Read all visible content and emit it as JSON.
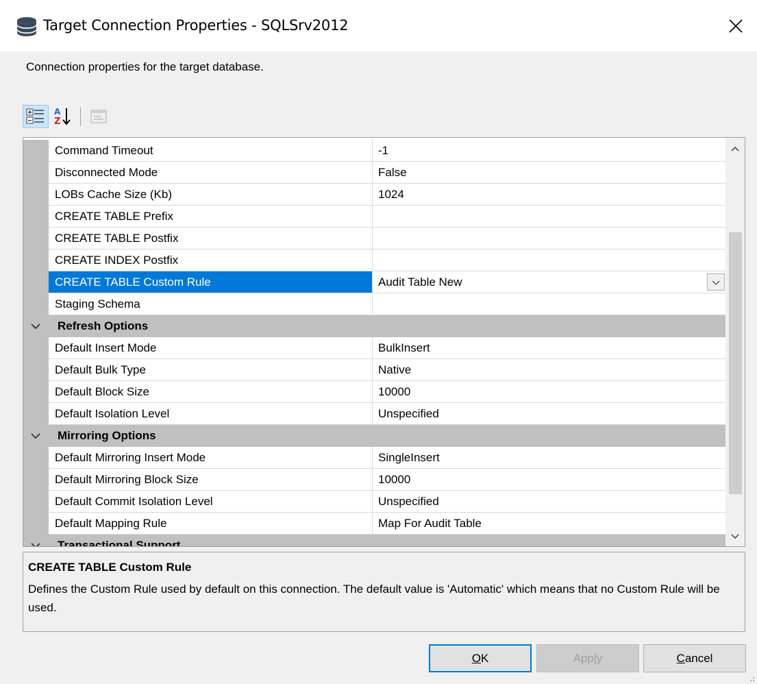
{
  "window": {
    "title": "Target Connection Properties - SQLSrv2012",
    "description": "Connection properties for the target database."
  },
  "toolbar": {
    "buttons": [
      {
        "icon": "categorized-icon",
        "active": true
      },
      {
        "icon": "alphabetical-sort-icon",
        "active": false
      },
      {
        "icon": "property-pages-icon",
        "active": false,
        "disabled": true
      }
    ]
  },
  "grid": {
    "rows_top": [
      {
        "name": "Command Timeout",
        "value": "-1"
      },
      {
        "name": "Disconnected Mode",
        "value": "False"
      },
      {
        "name": "LOBs Cache Size (Kb)",
        "value": "1024"
      },
      {
        "name": "CREATE TABLE Prefix",
        "value": ""
      },
      {
        "name": "CREATE TABLE Postfix",
        "value": ""
      },
      {
        "name": "CREATE INDEX Postfix",
        "value": ""
      },
      {
        "name": "CREATE TABLE Custom Rule",
        "value": "Audit Table New",
        "selected": true
      },
      {
        "name": "Staging Schema",
        "value": ""
      }
    ],
    "refresh": {
      "label": "Refresh Options",
      "rows": [
        {
          "name": "Default Insert Mode",
          "value": "BulkInsert"
        },
        {
          "name": "Default Bulk Type",
          "value": "Native"
        },
        {
          "name": "Default Block Size",
          "value": "10000"
        },
        {
          "name": "Default Isolation Level",
          "value": "Unspecified"
        }
      ]
    },
    "mirroring": {
      "label": "Mirroring Options",
      "rows": [
        {
          "name": "Default Mirroring Insert Mode",
          "value": "SingleInsert"
        },
        {
          "name": "Default Mirroring Block Size",
          "value": "10000"
        },
        {
          "name": "Default Commit Isolation Level",
          "value": "Unspecified"
        },
        {
          "name": "Default Mapping Rule",
          "value": "Map For Audit Table"
        }
      ]
    },
    "transactional": {
      "label": "Transactional Support"
    }
  },
  "help": {
    "title": "CREATE TABLE Custom Rule",
    "text": "Defines the Custom Rule used by default on this connection. The default value is 'Automatic' which means that no Custom Rule will be used."
  },
  "buttons": {
    "ok_prefix": "",
    "ok_mnemonic": "O",
    "ok_rest": "K",
    "apply_prefix": "App",
    "apply_mnemonic": "l",
    "apply_rest": "y",
    "cancel_prefix": "",
    "cancel_mnemonic": "C",
    "cancel_rest": "ancel"
  },
  "colors": {
    "selection": "#0078d7",
    "category_bg": "#c0c0c0"
  }
}
